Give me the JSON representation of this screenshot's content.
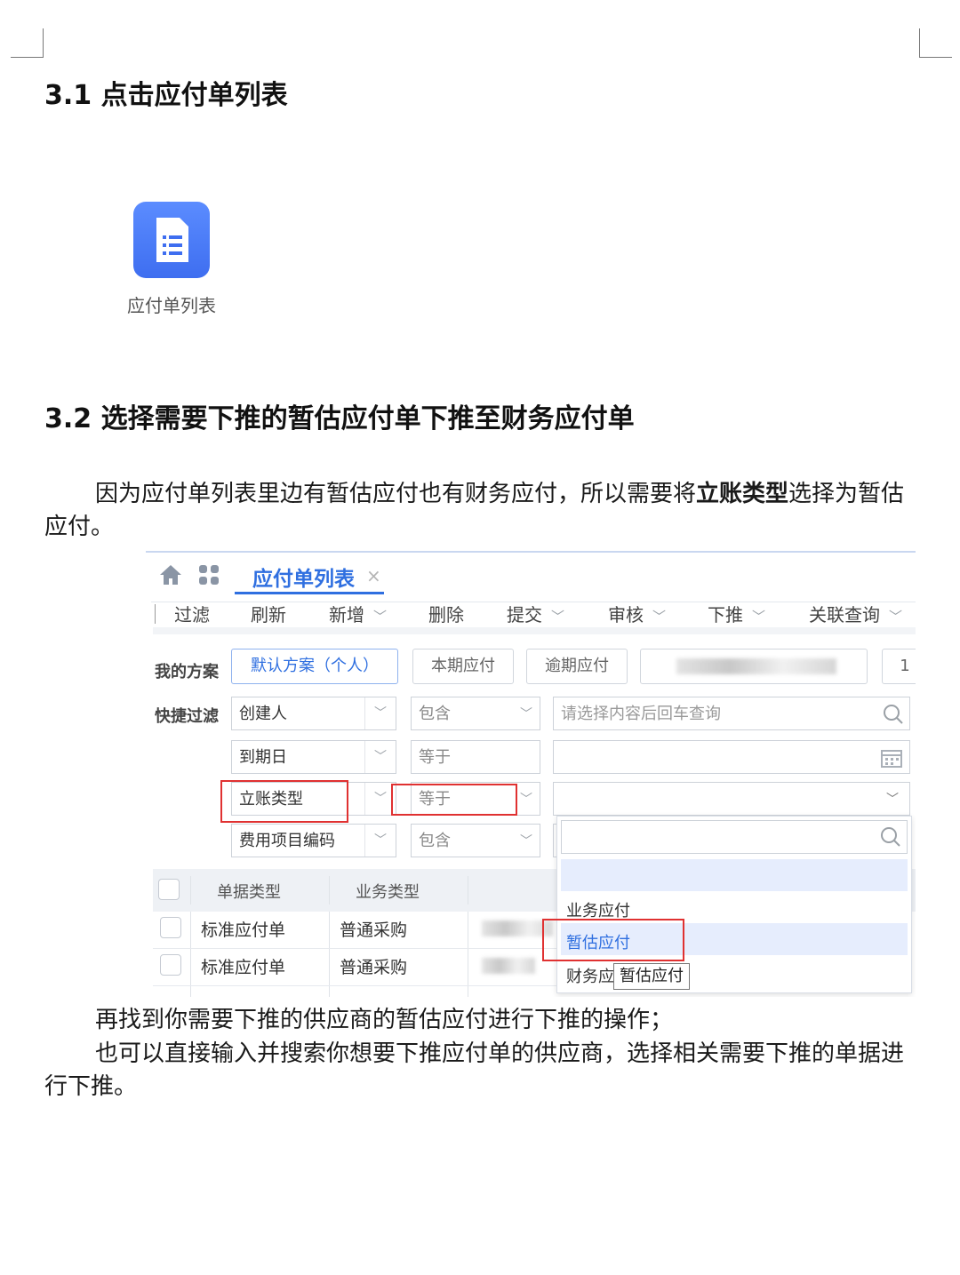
{
  "section1": {
    "heading": "3.1 点击应付单列表",
    "app_icon": "document-list-icon",
    "app_label": "应付单列表"
  },
  "section2": {
    "heading": "3.2 选择需要下推的暂估应付单下推至财务应付单",
    "intro_before": "因为应付单列表里边有暂估应付也有财务应付，所以需要将",
    "intro_bold": "立账类型",
    "intro_after": "选择为暂估应付。"
  },
  "screenshot": {
    "tab": {
      "title": "应付单列表",
      "close": "×",
      "icons": [
        "home-icon",
        "apps-grid-icon"
      ]
    },
    "toolbar": [
      "过滤",
      "刷新",
      "新增",
      "删除",
      "提交",
      "审核",
      "下推",
      "关联查询"
    ],
    "my_plan": {
      "label": "我的方案",
      "buttons": [
        "默认方案（个人）",
        "本期应付",
        "逾期应付"
      ],
      "extra": "1"
    },
    "quick_filter": {
      "label": "快捷过滤",
      "rows": [
        {
          "field": "创建人",
          "operator": "包含",
          "value_placeholder": "请选择内容后回车查询",
          "value_icon": "search-icon"
        },
        {
          "field": "到期日",
          "operator": "等于",
          "value_placeholder": "",
          "value_icon": "calendar-icon"
        },
        {
          "field": "立账类型",
          "operator": "等于",
          "value_placeholder": "",
          "value_icon": "chevron-down-icon"
        },
        {
          "field": "费用项目编码",
          "operator": "包含",
          "value_placeholder": "",
          "value_icon": ""
        }
      ]
    },
    "table": {
      "columns": [
        "单据类型",
        "业务类型"
      ],
      "rows": [
        {
          "doc_type": "标准应付单",
          "biz_type": "普通采购"
        },
        {
          "doc_type": "标准应付单",
          "biz_type": "普通采购"
        }
      ]
    },
    "dropdown": {
      "options": [
        "业务应付",
        "暂估应付",
        "财务应"
      ],
      "selected": "暂估应付",
      "tooltip": "暂估应付",
      "search_icon": "search-icon"
    },
    "accent_color": "#2f6fe0",
    "highlight_color": "#e03131"
  },
  "after_text": {
    "line1": "再找到你需要下推的供应商的暂估应付进行下推的操作；",
    "line2": "也可以直接输入并搜索你想要下推应付单的供应商，选择相关需要下推的单据进行下推。"
  }
}
